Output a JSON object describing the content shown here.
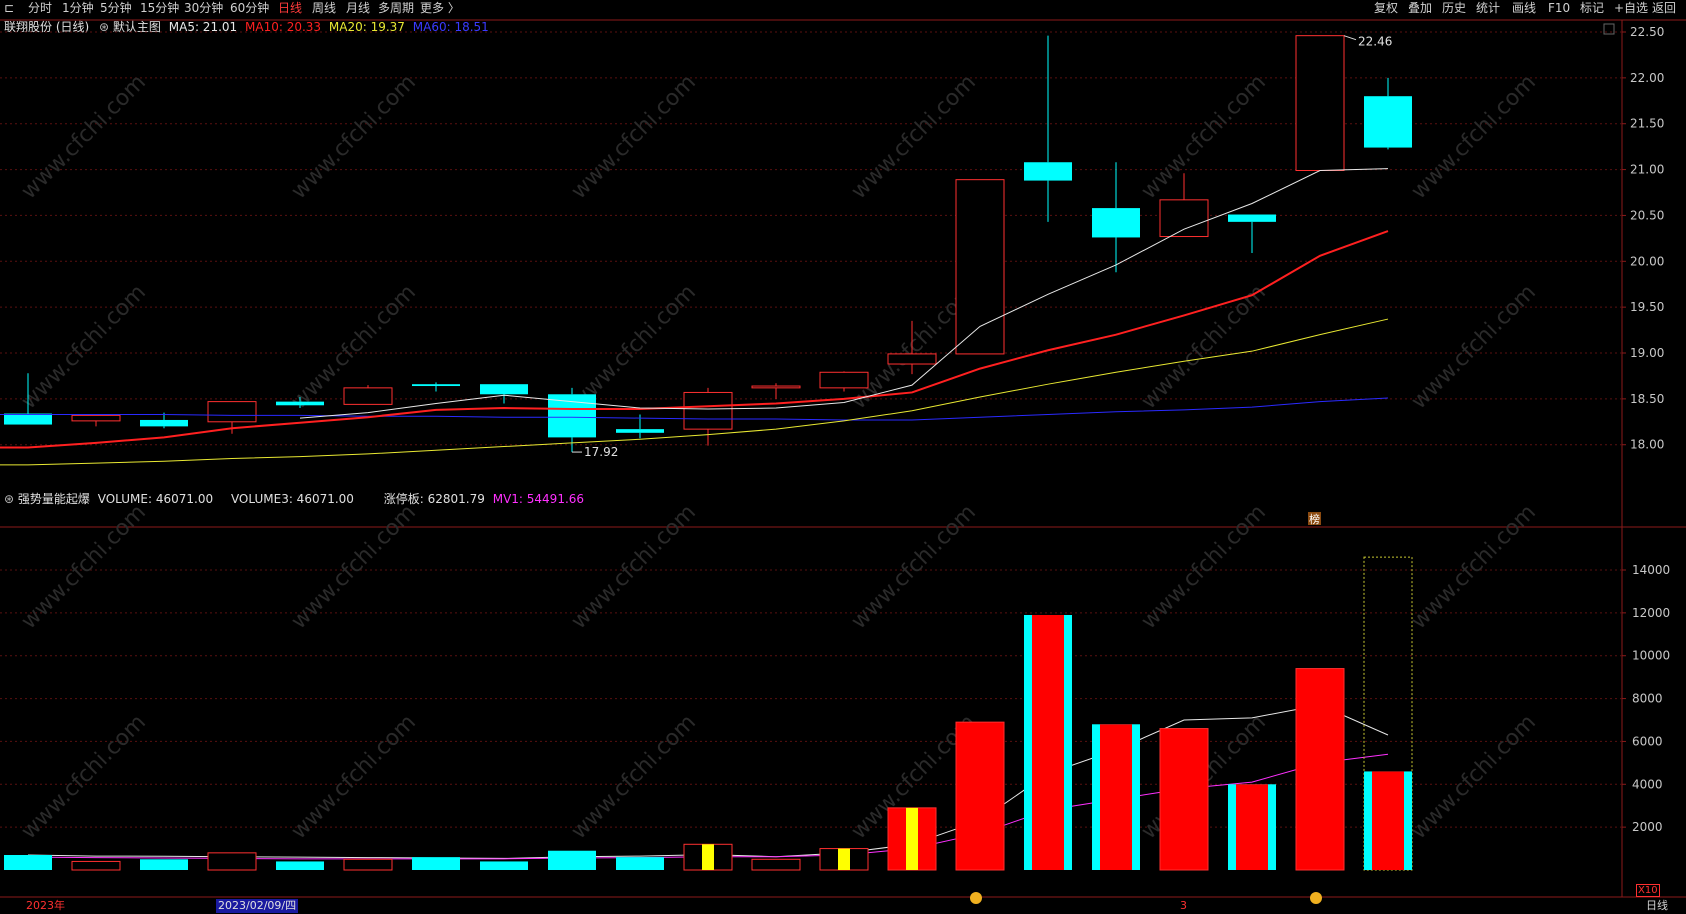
{
  "toolbar": {
    "left": [
      "分时",
      "1分钟",
      "5分钟",
      "15分钟",
      "30分钟",
      "60分钟",
      "日线",
      "周线",
      "月线",
      "多周期",
      "更多 〉"
    ],
    "active": "日线",
    "right": [
      "复权",
      "叠加",
      "历史",
      "统计",
      "画线",
      "F10",
      "标记",
      "+自选",
      "返回"
    ]
  },
  "main_header": {
    "title": "联翔股份 (日线)",
    "indicator": "默认主图",
    "ma5": "MA5: 21.01",
    "ma10": "MA10: 20.33",
    "ma20": "MA20: 19.37",
    "ma60": "MA60: 18.51"
  },
  "sub_header": {
    "title": "强势量能起爆",
    "volume": "VOLUME: 46071.00",
    "volume3": "VOLUME3: 46071.00",
    "limit": "涨停板: 62801.79",
    "mv1": "MV1: 54491.66"
  },
  "annotations": {
    "high": "22.46",
    "low": "17.92",
    "bang": "榜"
  },
  "bottom": {
    "year": "2023年",
    "date": "2023/02/09/四",
    "mark": "3",
    "scale": "X10",
    "period": "日线"
  },
  "colors": {
    "up": "#ff3030",
    "down": "#00ffff",
    "ma5": "#e8e8e8",
    "ma10": "#ff2020",
    "ma20": "#e8e832",
    "ma60": "#2a2aff",
    "mv1": "#ff30ff"
  },
  "chart_data": [
    {
      "type": "candlestick",
      "title": "联翔股份 (日线)",
      "y_ticks": [
        "22.50",
        "22.00",
        "21.50",
        "21.00",
        "20.50",
        "20.00",
        "19.50",
        "19.00",
        "18.50",
        "18.00"
      ],
      "ylim": [
        17.55,
        22.5
      ],
      "candles": [
        {
          "o": 18.34,
          "c": 18.22,
          "h": 18.78,
          "l": 18.22
        },
        {
          "o": 18.26,
          "c": 18.32,
          "h": 18.32,
          "l": 18.2
        },
        {
          "o": 18.27,
          "c": 18.2,
          "h": 18.35,
          "l": 18.18
        },
        {
          "o": 18.25,
          "c": 18.47,
          "h": 18.47,
          "l": 18.12
        },
        {
          "o": 18.47,
          "c": 18.43,
          "h": 18.52,
          "l": 18.4
        },
        {
          "o": 18.44,
          "c": 18.62,
          "h": 18.65,
          "l": 18.44
        },
        {
          "o": 18.66,
          "c": 18.64,
          "h": 18.68,
          "l": 18.58
        },
        {
          "o": 18.66,
          "c": 18.55,
          "h": 18.66,
          "l": 18.45
        },
        {
          "o": 18.55,
          "c": 18.08,
          "h": 18.62,
          "l": 17.92
        },
        {
          "o": 18.17,
          "c": 18.13,
          "h": 18.33,
          "l": 18.07
        },
        {
          "o": 18.17,
          "c": 18.57,
          "h": 18.62,
          "l": 17.99
        },
        {
          "o": 18.62,
          "c": 18.64,
          "h": 18.67,
          "l": 18.5
        },
        {
          "o": 18.62,
          "c": 18.79,
          "h": 18.8,
          "l": 18.58
        },
        {
          "o": 18.88,
          "c": 18.99,
          "h": 19.35,
          "l": 18.77
        },
        {
          "o": 18.99,
          "c": 20.89,
          "h": 20.89,
          "l": 18.99
        },
        {
          "o": 21.08,
          "c": 20.88,
          "h": 22.46,
          "l": 20.43
        },
        {
          "o": 20.58,
          "c": 20.26,
          "h": 21.08,
          "l": 19.88
        },
        {
          "o": 20.27,
          "c": 20.67,
          "h": 20.96,
          "l": 20.27
        },
        {
          "o": 20.51,
          "c": 20.43,
          "h": 20.51,
          "l": 20.09
        },
        {
          "o": 20.99,
          "c": 22.46,
          "h": 22.46,
          "l": 20.99
        },
        {
          "o": 21.8,
          "c": 21.24,
          "h": 22.0,
          "l": 21.22
        }
      ],
      "ma5": [
        null,
        null,
        null,
        null,
        18.29,
        18.35,
        18.45,
        18.54,
        18.47,
        18.4,
        18.39,
        18.4,
        18.46,
        18.65,
        19.29,
        19.64,
        19.96,
        20.35,
        20.63,
        20.99,
        21.01
      ],
      "ma10": [
        17.97,
        18.02,
        18.08,
        18.18,
        18.24,
        18.3,
        18.38,
        18.4,
        18.39,
        18.39,
        18.42,
        18.45,
        18.5,
        18.57,
        18.83,
        19.03,
        19.2,
        19.41,
        19.63,
        20.06,
        20.33
      ],
      "ma20": [
        17.78,
        17.8,
        17.82,
        17.85,
        17.87,
        17.9,
        17.94,
        17.98,
        18.02,
        18.06,
        18.11,
        18.17,
        18.26,
        18.37,
        18.52,
        18.66,
        18.79,
        18.91,
        19.02,
        19.2,
        19.37
      ],
      "ma60": [
        18.33,
        18.33,
        18.33,
        18.32,
        18.32,
        18.31,
        18.31,
        18.3,
        18.3,
        18.29,
        18.28,
        18.28,
        18.27,
        18.27,
        18.3,
        18.33,
        18.36,
        18.38,
        18.41,
        18.47,
        18.51
      ]
    },
    {
      "type": "bar",
      "title": "强势量能起爆",
      "y_ticks": [
        "14000",
        "12000",
        "10000",
        "8000",
        "6000",
        "4000",
        "2000"
      ],
      "ylim": [
        0,
        15400
      ],
      "volume": [
        700,
        400,
        500,
        800,
        400,
        500,
        600,
        400,
        900,
        600,
        1200,
        500,
        1000,
        2900,
        6900,
        11900,
        6800,
        6600,
        4000,
        9400,
        4600
      ],
      "limit_bar": [
        null,
        null,
        null,
        null,
        null,
        null,
        null,
        null,
        null,
        null,
        null,
        null,
        null,
        null,
        null,
        null,
        null,
        null,
        null,
        null,
        14600
      ],
      "highlight": [
        null,
        null,
        null,
        null,
        null,
        null,
        null,
        null,
        null,
        null,
        1200,
        null,
        1000,
        2900,
        null,
        null,
        null,
        null,
        null,
        null,
        null
      ],
      "mv_white": [
        700,
        650,
        640,
        620,
        600,
        580,
        560,
        540,
        620,
        650,
        720,
        620,
        800,
        1200,
        2300,
        4500,
        5600,
        7000,
        7100,
        7700,
        6300
      ],
      "mv1": [
        600,
        580,
        560,
        540,
        520,
        520,
        520,
        520,
        560,
        580,
        620,
        620,
        700,
        1000,
        1700,
        2800,
        3300,
        3800,
        4100,
        5000,
        5400
      ]
    }
  ]
}
